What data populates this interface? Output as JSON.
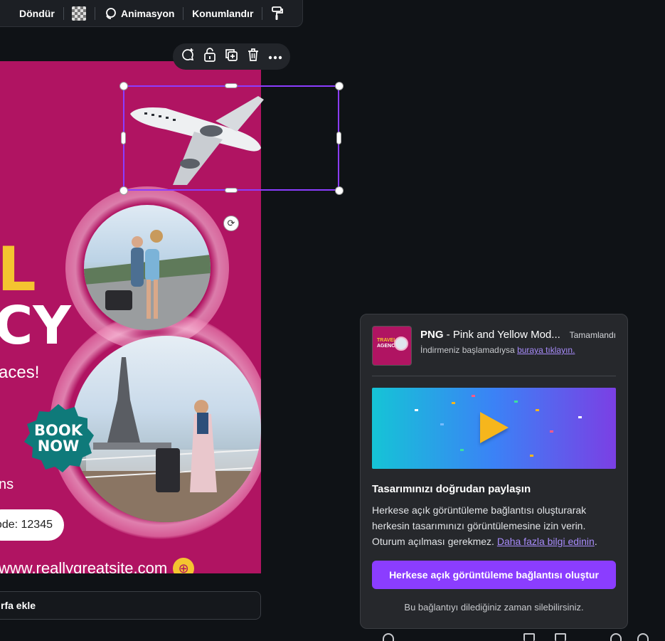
{
  "toolbar": {
    "rotate_label": "Döndür",
    "transparency_icon": "checkerboard-icon",
    "animate_label": "Animasyon",
    "position_label": "Konumlandır",
    "paint_icon": "paint-roller-icon"
  },
  "context_menu": {
    "icons": [
      "comment-add-icon",
      "lock-icon",
      "duplicate-icon",
      "trash-icon",
      "more-icon"
    ]
  },
  "design": {
    "big_letter": "L",
    "big_word": "CY",
    "places_text": "aces!",
    "badge_line1": "BOOK",
    "badge_line2": "NOW",
    "ns_text": "ns",
    "promo_code": "ode: 12345",
    "website": "www.reallygreatsite.com",
    "accent": "#b01462",
    "yellow": "#f4c430"
  },
  "add_page_label": "rfa ekle",
  "download": {
    "file_name_prefix": "PNG",
    "file_name_rest": " - Pink and Yellow Mod...",
    "status": "Tamamlandı",
    "hint_text": "İndirmeniz başlamadıysa ",
    "hint_link": "buraya tıklayın.",
    "thumb_line1": "TRAVEL",
    "thumb_line2": "AGENCY"
  },
  "share": {
    "heading": "Tasarımınızı doğrudan paylaşın",
    "body": "Herkese açık görüntüleme bağlantısı oluşturarak herkesin tasarımınızı görüntülemesine izin verin. Oturum açılması gerekmez. ",
    "learn_more": "Daha fazla bilgi edinin",
    "period": ".",
    "cta_label": "Herkese açık görüntüleme bağlantısı oluştur",
    "note": "Bu bağlantıyı dilediğiniz zaman silebilirsiniz.",
    "brand_purple": "#8b3dff"
  }
}
